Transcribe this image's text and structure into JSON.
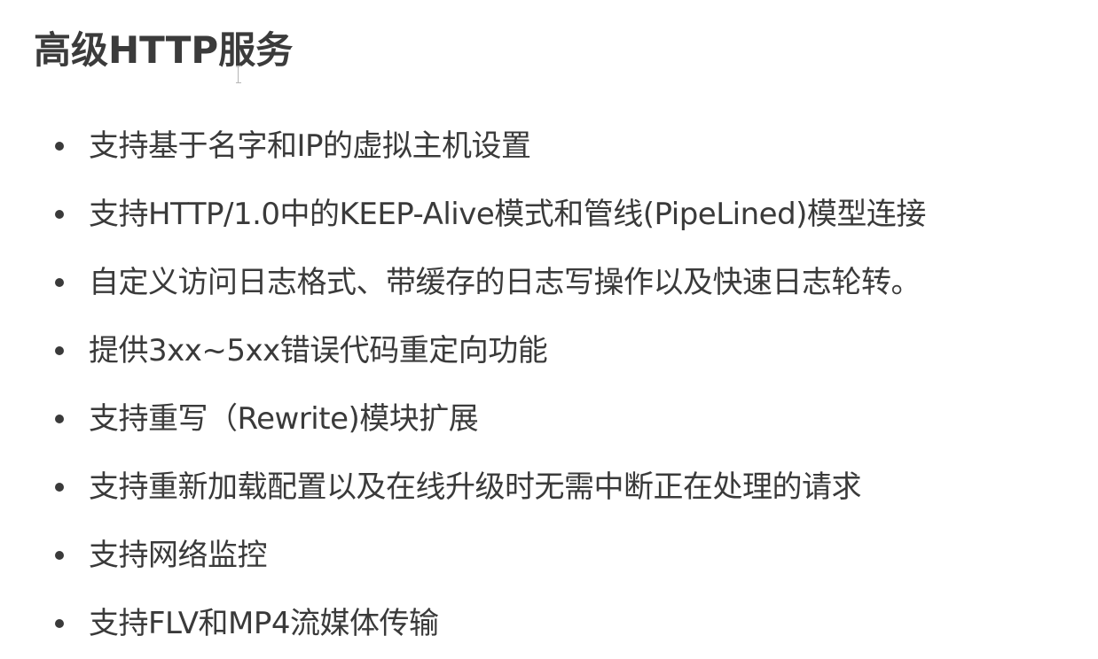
{
  "title": "高级HTTP服务",
  "items": [
    {
      "label": "支持基于名字和IP的虚拟主机设置"
    },
    {
      "label": "支持HTTP/1.0中的KEEP-Alive模式和管线(PipeLined)模型连接"
    },
    {
      "label": "自定义访问日志格式、带缓存的日志写操作以及快速日志轮转。"
    },
    {
      "label": "提供3xx~5xx错误代码重定向功能"
    },
    {
      "label": "支持重写（Rewrite)模块扩展"
    },
    {
      "label": "支持重新加载配置以及在线升级时无需中断正在处理的请求"
    },
    {
      "label": "支持网络监控"
    },
    {
      "label": "支持FLV和MP4流媒体传输"
    }
  ]
}
